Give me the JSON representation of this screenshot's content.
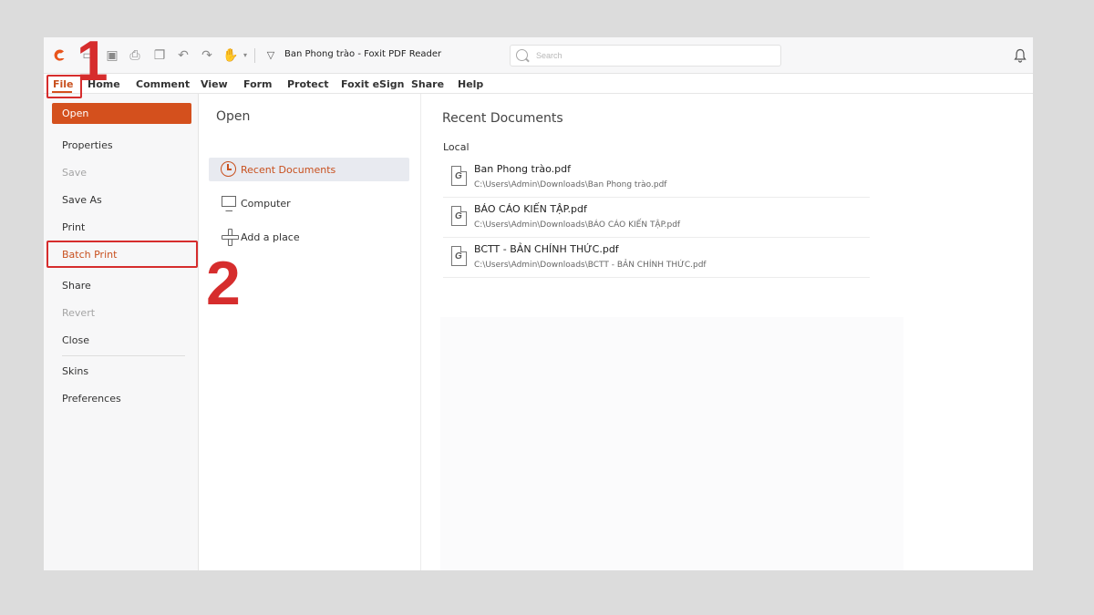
{
  "titlebar": {
    "app_title": "Ban Phong trào - Foxit PDF Reader",
    "search_placeholder": "Search",
    "icons": [
      "foxit-logo-icon",
      "new-icon",
      "save-icon",
      "print-icon",
      "page-icon",
      "undo-icon",
      "redo-icon",
      "hand-icon",
      "dropdown-icon",
      "customize-icon",
      "bell-icon"
    ]
  },
  "menubar": {
    "items": [
      "File",
      "Home",
      "Comment",
      "View",
      "Form",
      "Protect",
      "Foxit eSign",
      "Share",
      "Help"
    ]
  },
  "file_menu": {
    "items": [
      {
        "label": "Open",
        "state": "selected"
      },
      {
        "label": "Properties",
        "state": "normal"
      },
      {
        "label": "Save",
        "state": "disabled"
      },
      {
        "label": "Save As",
        "state": "normal"
      },
      {
        "label": "Print",
        "state": "normal"
      },
      {
        "label": "Batch Print",
        "state": "highlighted"
      },
      {
        "label": "Share",
        "state": "normal"
      },
      {
        "label": "Revert",
        "state": "disabled"
      },
      {
        "label": "Close",
        "state": "normal"
      },
      {
        "label": "Skins",
        "state": "normal"
      },
      {
        "label": "Preferences",
        "state": "normal"
      }
    ]
  },
  "open_pane": {
    "title": "Open",
    "places": [
      {
        "label": "Recent Documents",
        "icon": "clock-icon",
        "selected": true
      },
      {
        "label": "Computer",
        "icon": "monitor-icon",
        "selected": false
      },
      {
        "label": "Add a place",
        "icon": "plus-icon",
        "selected": false
      }
    ]
  },
  "recent": {
    "title": "Recent Documents",
    "section": "Local",
    "documents": [
      {
        "name": "Ban Phong trào.pdf",
        "path": "C:\\Users\\Admin\\Downloads\\Ban Phong trào.pdf"
      },
      {
        "name": "BÁO CÁO KIẾN TẬP.pdf",
        "path": "C:\\Users\\Admin\\Downloads\\BÁO CÁO KIẾN TẬP.pdf"
      },
      {
        "name": "BCTT - BẢN CHÍNH THỨC.pdf",
        "path": "C:\\Users\\Admin\\Downloads\\BCTT - BẢN CHÍNH THỨC.pdf"
      }
    ]
  },
  "annotations": {
    "step1": "1",
    "step2": "2",
    "color": "#d62d2d"
  },
  "colors": {
    "accent": "#d4501d",
    "annotation": "#d62d2d"
  }
}
